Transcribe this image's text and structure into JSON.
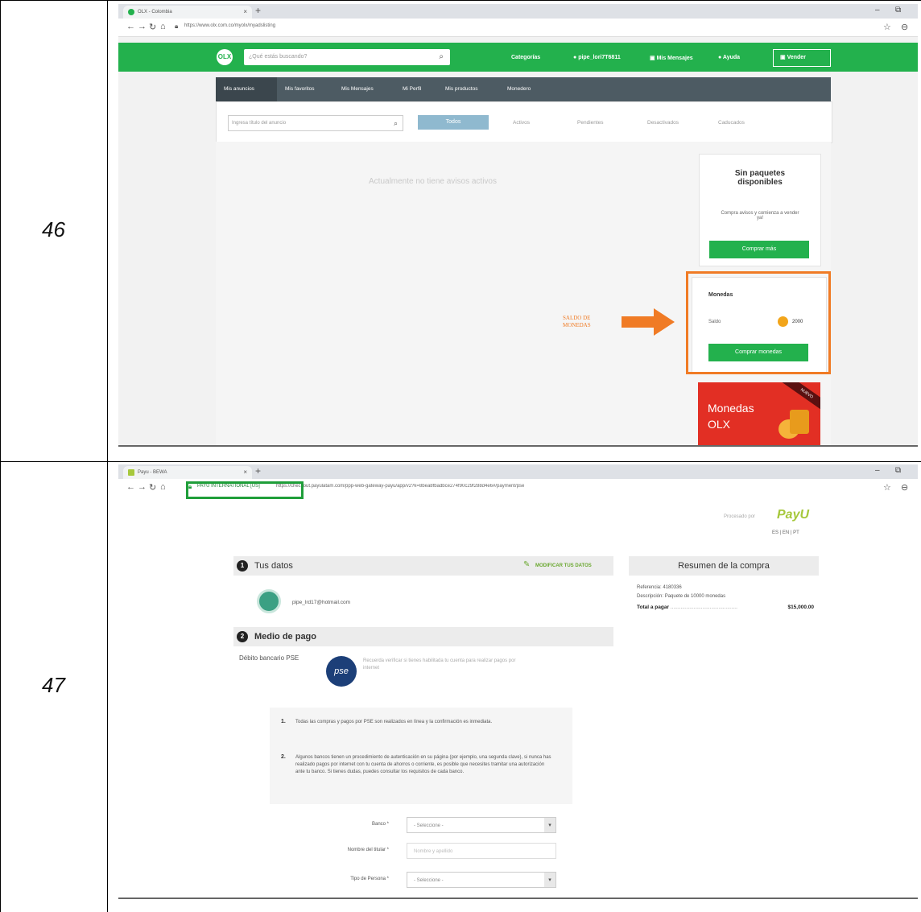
{
  "rows": [
    {
      "number": "46"
    },
    {
      "number": "47"
    }
  ],
  "shot1": {
    "tab_title": "OLX - Colombia",
    "url": "https://www.olx.com.co/myolx/myadslisting",
    "logo": "OLX",
    "search_placeholder": "¿Qué estás buscando?",
    "header_links": [
      "Categorías",
      "pipe_lori7T6811",
      "Mis Mensajes",
      "Ayuda"
    ],
    "sell_label": "Vender",
    "subnav": [
      "Mis anuncios",
      "Mis favoritos",
      "Mis Mensajes",
      "Mi Perfil",
      "Mis productos",
      "Monedero"
    ],
    "filter_placeholder": "Ingresa título del anuncio",
    "filter_tabs": [
      "Todos",
      "Activos",
      "Pendientes",
      "Desactivados",
      "Caducados"
    ],
    "empty_message": "Actualmente no tiene avisos activos",
    "packages_title": "Sin paquetes disponibles",
    "packages_text": "Compra avisos y comienza a vender ya!",
    "packages_button": "Comprar más",
    "coins_title": "Monedas",
    "coins_label": "Saldo",
    "coins_value": "2000",
    "coins_button": "Comprar monedas",
    "annotation": "SALDO DE MONEDAS",
    "promo_badge": "NUEVO",
    "promo_line1": "Monedas",
    "promo_line2": "OLX",
    "colors": {
      "olx_green": "#23b14d",
      "highlight": "#f07b25",
      "promo_red": "#e22f24"
    }
  },
  "shot2": {
    "tab_title": "Payu - BEWA",
    "url_secure": "PAYU INTERNATIONAL [US]",
    "url": "https://checkout.payulatam.com/ppp-web-gateway-payu/app/v2?k=8bea8fbadbce274f90c29f288d4e6#/payment/pse",
    "payu_badge": "Procesado por",
    "payu_logo": "PayU",
    "lang": "ES | EN | PT",
    "step1_num": "1",
    "step1_title": "Tus datos",
    "step1_action": "MODIFICAR TUS DATOS",
    "email": "pipe_lrd17@hotmail.com",
    "step2_num": "2",
    "step2_title": "Medio de pago",
    "method_label": "Débito bancario PSE",
    "pse_logo": "pse",
    "pse_note": "Recuerda verificar si tienes habilitada tu cuenta para realizar pagos por internet",
    "instructions": [
      {
        "n": "1.",
        "text": "Todas las compras y pagos por PSE son realizados en línea y la confirmación es inmediata."
      },
      {
        "n": "2.",
        "text": "Algunos bancos tienen un procedimiento de autenticación en su página (por ejemplo, una segunda clave), si nunca has realizado pagos por internet con tu cuenta de ahorros o corriente, es posible que necesites tramitar una autorización ante tu banco. Si tienes dudas, puedes consultar los requisitos de cada banco."
      }
    ],
    "form": [
      {
        "label": "Banco *",
        "value": "- Seleccione -",
        "type": "select"
      },
      {
        "label": "Nombre del titular *",
        "value": "Nombre y apellido",
        "type": "input"
      },
      {
        "label": "Tipo de Persona *",
        "value": "- Seleccione -",
        "type": "select"
      }
    ],
    "summary_title": "Resumen de la compra",
    "ref_label": "Referencia:",
    "ref_value": "4180336",
    "desc_label": "Descripción:",
    "desc_value": "Paquete de 10000 monedas",
    "total_label": "Total a pagar",
    "total_value": "$15,000.00",
    "colors": {
      "green_frame": "#1f9e3a",
      "link_green": "#6aa82f"
    }
  }
}
